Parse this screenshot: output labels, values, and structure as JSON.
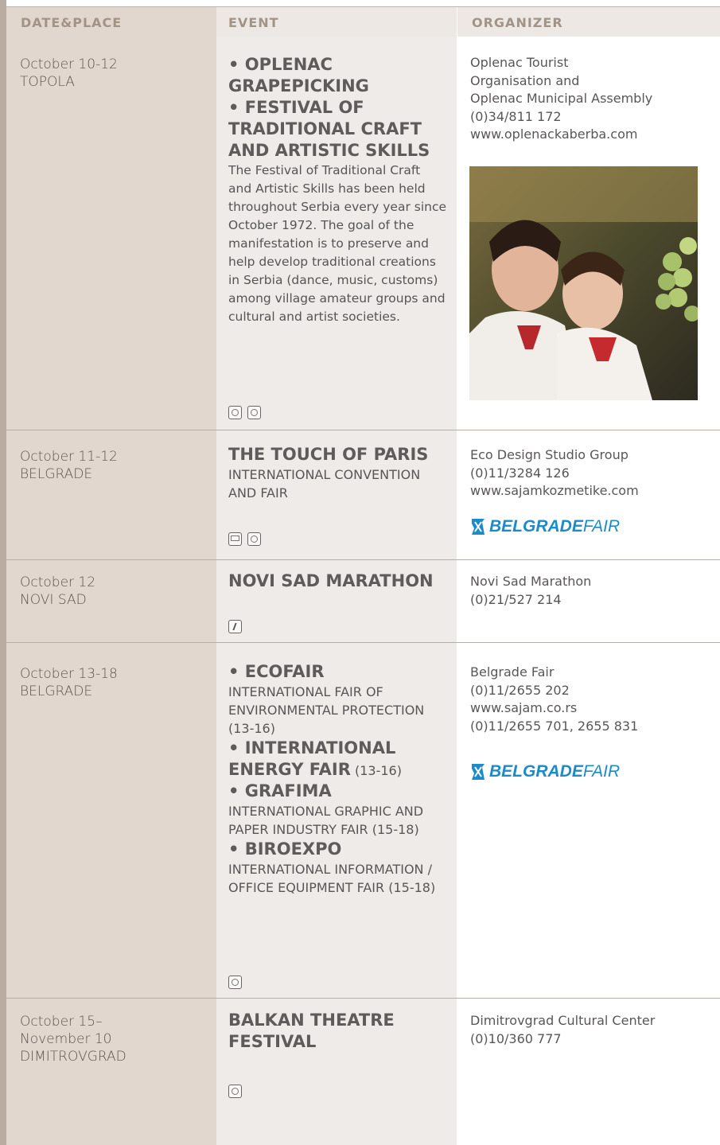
{
  "header": {
    "col1": "DATE&PLACE",
    "col2": "EVENT",
    "col3": "ORGANIZER"
  },
  "rows": [
    {
      "date": "October 10-12",
      "place": "TOPOLA",
      "title1": "• OPLENAC GRAPEPICKING",
      "title2": "• FESTIVAL OF TRADITIONAL CRAFT AND ARTISTIC SKILLS",
      "description": "The Festival of Traditional Craft and Artistic Skills has been held throughout Serbia every year since October 1972. The goal of the manifestation is to preserve and help develop traditional creations in Serbia (dance, music, customs) among village amateur groups and cultural and artist societies.",
      "organizer": [
        "Oplenac Tourist",
        "Organisation and",
        "Oplenac Municipal Assembly",
        "(0)34/811 172",
        "www.oplenackaberba.com"
      ],
      "icons": [
        "folklore-icon",
        "theatre-masks-icon"
      ]
    },
    {
      "date": "October 11-12",
      "place": "BELGRADE",
      "title": "THE TOUCH OF PARIS",
      "subtitle": "INTERNATIONAL CONVENTION AND FAIR",
      "organizer": [
        "Eco Design Studio Group",
        "(0)11/3284 126",
        "www.sajamkozmetike.com"
      ],
      "icons": [
        "exhibition-icon",
        "globe-icon"
      ]
    },
    {
      "date": "October 12",
      "place": "NOVI SAD",
      "title": "NOVI SAD MARATHON",
      "organizer": [
        "Novi Sad Marathon",
        "(0)21/527 214"
      ],
      "icons": [
        "runner-icon"
      ]
    },
    {
      "date": "October 13-18",
      "place": "BELGRADE",
      "items": [
        {
          "title": "• ECOFAIR",
          "sub": "INTERNATIONAL FAIR OF ENVIRONMENTAL PROTECTION (13-16)"
        },
        {
          "title": "• INTERNATIONAL ENERGY FAIR",
          "sub": "(13-16)"
        },
        {
          "title": "• GRAFIMA",
          "sub": "INTERNATIONAL GRAPHIC AND PAPER INDUSTRY FAIR (15-18)"
        },
        {
          "title": "• BIROEXPO",
          "sub": "INTERNATIONAL INFORMATION / OFFICE EQUIPMENT FAIR (15-18)"
        }
      ],
      "organizer": [
        "Belgrade Fair",
        "(0)11/2655 202",
        "www.sajam.co.rs",
        "(0)11/2655 701, 2655 831"
      ],
      "icons": [
        "globe-icon"
      ]
    },
    {
      "date": "October 15–",
      "date2": "November 10",
      "place": "DIMITROVGRAD",
      "title": "BALKAN THEATRE FESTIVAL",
      "organizer": [
        "Dimitrovgrad Cultural Center",
        "(0)10/360 777"
      ],
      "icons": [
        "theatre-masks-icon"
      ]
    }
  ],
  "logo": {
    "word1": "BELGRADE",
    "word2": "FAIR",
    "color": "#1c8bc9"
  },
  "colors": {
    "header_text": "#a29387",
    "col1_bg": "#e2d7ce",
    "col2_bg": "#efebe8"
  }
}
